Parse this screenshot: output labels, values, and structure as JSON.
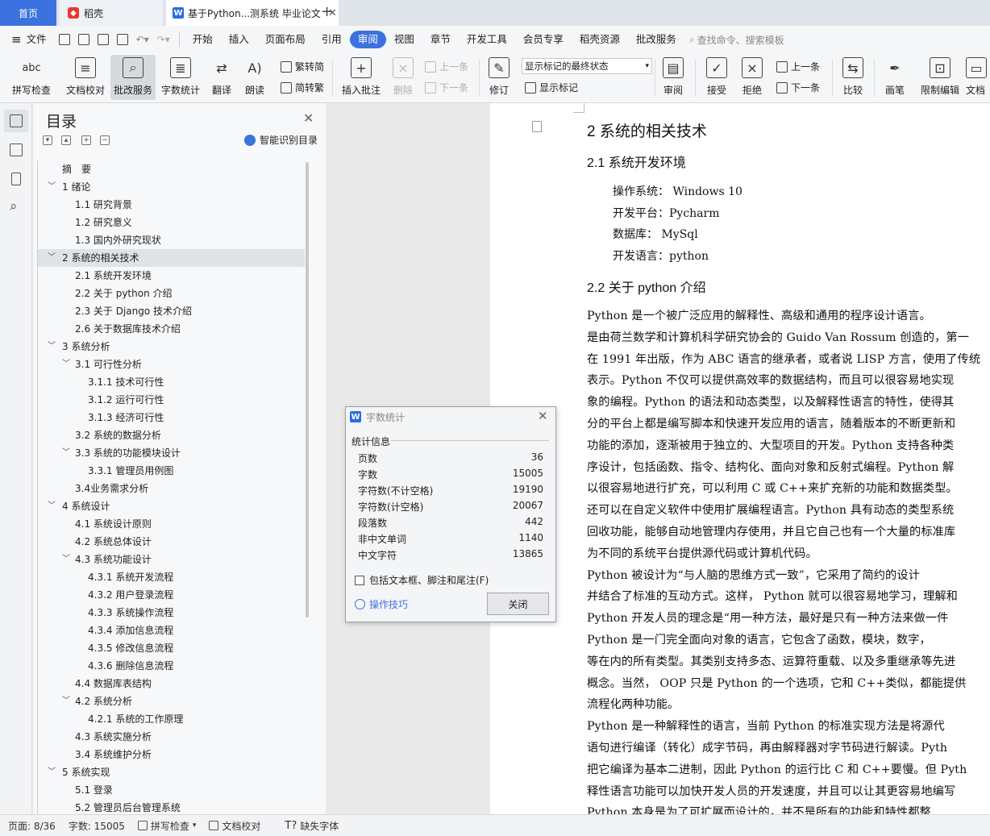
{
  "tabs": {
    "home": "首页",
    "daoke": "稻壳",
    "doc": "基于Python...测系统 毕业论文",
    "new_tab": "+",
    "close": "✕"
  },
  "menu": [
    "文件",
    "开始",
    "插入",
    "页面布局",
    "引用",
    "审阅",
    "视图",
    "章节",
    "开发工具",
    "会员专享",
    "稻壳资源",
    "批改服务"
  ],
  "menu_search": "查找命令、搜索模板",
  "ribbon": {
    "spell_check": "拼写检查",
    "doc_check": "文档校对",
    "review_service": "批改服务",
    "word_count": "字数统计",
    "translate": "翻译",
    "read_aloud": "朗读",
    "trad_convert": "繁转简",
    "simp_convert": "简转繁",
    "insert_comment": "插入批注",
    "delete": "删除",
    "prev_item": "上一条",
    "next_item": "下一条",
    "revise": "修订",
    "markup_select": "显示标记的最终状态",
    "show_markup": "显示标记",
    "review": "审阅",
    "accept": "接受",
    "reject": "拒绝",
    "prev_item2": "上一条",
    "next_item2": "下一条",
    "compare": "比较",
    "pen": "画笔",
    "restrict_edit": "限制编辑",
    "doc_more": "文档"
  },
  "toc": {
    "title": "目录",
    "smart": "智能识别目录",
    "items": [
      {
        "label": "摘　要",
        "level": 0,
        "arrow": ""
      },
      {
        "label": "1  绪论",
        "level": 0,
        "arrow": "﹀"
      },
      {
        "label": "1.1  研究背景",
        "level": 1,
        "arrow": ""
      },
      {
        "label": "1.2  研究意义",
        "level": 1,
        "arrow": ""
      },
      {
        "label": "1.3  国内外研究现状",
        "level": 1,
        "arrow": ""
      },
      {
        "label": "2  系统的相关技术",
        "level": 0,
        "arrow": "﹀"
      },
      {
        "label": "2.1  系统开发环境",
        "level": 1,
        "arrow": ""
      },
      {
        "label": "2.2    关于 python 介绍",
        "level": 1,
        "arrow": ""
      },
      {
        "label": "2.3  关于 Django 技术介绍",
        "level": 1,
        "arrow": ""
      },
      {
        "label": "2.6  关于数据库技术介绍",
        "level": 1,
        "arrow": ""
      },
      {
        "label": "3  系统分析",
        "level": 0,
        "arrow": "﹀"
      },
      {
        "label": "3.1  可行性分析",
        "level": 1,
        "arrow": "﹀"
      },
      {
        "label": "3.1.1  技术可行性",
        "level": 2,
        "arrow": ""
      },
      {
        "label": "3.1.2  运行可行性",
        "level": 2,
        "arrow": ""
      },
      {
        "label": "3.1.3  经济可行性",
        "level": 2,
        "arrow": ""
      },
      {
        "label": "3.2  系统的数据分析",
        "level": 1,
        "arrow": ""
      },
      {
        "label": "3.3  系统的功能模块设计",
        "level": 1,
        "arrow": "﹀"
      },
      {
        "label": "3.3.1 管理员用例图",
        "level": 2,
        "arrow": ""
      },
      {
        "label": "3.4业务需求分析",
        "level": 1,
        "arrow": ""
      },
      {
        "label": "4  系统设计",
        "level": 0,
        "arrow": "﹀"
      },
      {
        "label": "4.1  系统设计原则",
        "level": 1,
        "arrow": ""
      },
      {
        "label": "4.2  系统总体设计",
        "level": 1,
        "arrow": ""
      },
      {
        "label": "4.3  系统功能设计",
        "level": 1,
        "arrow": "﹀"
      },
      {
        "label": "4.3.1  系统开发流程",
        "level": 2,
        "arrow": ""
      },
      {
        "label": "4.3.2  用户登录流程",
        "level": 2,
        "arrow": ""
      },
      {
        "label": "4.3.3  系统操作流程",
        "level": 2,
        "arrow": ""
      },
      {
        "label": "4.3.4  添加信息流程",
        "level": 2,
        "arrow": ""
      },
      {
        "label": "4.3.5  修改信息流程",
        "level": 2,
        "arrow": ""
      },
      {
        "label": "4.3.6  删除信息流程",
        "level": 2,
        "arrow": ""
      },
      {
        "label": "4.4 数据库表结构",
        "level": 1,
        "arrow": ""
      },
      {
        "label": "4.2  系统分析",
        "level": 1,
        "arrow": "﹀"
      },
      {
        "label": "4.2.1  系统的工作原理",
        "level": 2,
        "arrow": ""
      },
      {
        "label": "4.3     系统实施分析",
        "level": 1,
        "arrow": ""
      },
      {
        "label": "3.4     系统维护分析",
        "level": 1,
        "arrow": ""
      },
      {
        "label": "5  系统实现",
        "level": 0,
        "arrow": "﹀"
      },
      {
        "label": "5.1 登录",
        "level": 1,
        "arrow": ""
      },
      {
        "label": "5.2 管理员后台管理系统",
        "level": 1,
        "arrow": ""
      }
    ]
  },
  "document": {
    "h1": "2  系统的相关技术",
    "h2_1": "2.1  系统开发环境",
    "env": [
      "操作系统：  Windows 10",
      "开发平台：Pycharm",
      "数据库：  MySql",
      "开发语言：python"
    ],
    "h2_2": "2.2    关于 python 介绍",
    "lines": [
      "    Python 是一个被广泛应用的解释性、高级和通用的程序设计语言。",
      "是由荷兰数学和计算机科学研究协会的 Guido Van Rossum 创造的，第一",
      "在 1991 年出版，作为 ABC 语言的继承者，或者说 LISP 方言，使用了传统",
      "表示。Python 不仅可以提供高效率的数据结构，而且可以很容易地实现",
      "象的编程。Python 的语法和动态类型，以及解释性语言的特性，使得其",
      "分的平台上都是编写脚本和快速开发应用的语言，随着版本的不断更新和",
      "功能的添加，逐渐被用于独立的、大型项目的开发。Python 支持各种类",
      "序设计，包括函数、指令、结构化、面向对象和反射式编程。Python 解",
      "以很容易地进行扩充，可以利用 C 或 C++来扩充新的功能和数据类型。",
      "还可以在自定义软件中使用扩展编程语言。Python 具有动态的类型系统",
      "回收功能，能够自动地管理内存使用，并且它自己也有一个大量的标准库",
      "为不同的系统平台提供源代码或计算机代码。",
      "    Python 被设计为“与人脑的思维方式一致”，它采用了简约的设计",
      "并结合了标准的互动方式。这样，  Python 就可以很容易地学习，理解和",
      "Python 开发人员的理念是“用一种方法，最好是只有一种方法来做一件",
      "    Python 是一门完全面向对象的语言，它包含了函数，模块，数字，",
      "等在内的所有类型。其类别支持多态、运算符重载、以及多重继承等先进",
      "概念。当然，  OOP 只是 Python 的一个选项，它和 C++类似，都能提供",
      "流程化两种功能。",
      "    Python 是一种解释性的语言，当前 Python 的标准实现方法是将源代",
      "语句进行编译（转化）成字节码，再由解释器对字节码进行解读。Pyth",
      "把它编译为基本二进制，因此 Python 的运行比 C 和 C++要慢。但 Pyth",
      "释性语言功能可以加快开发人员的开发速度，并且可以让其更容易地编写",
      "    Python 本身是为了可扩展而设计的，并不是所有的功能和特性都整"
    ]
  },
  "dialog": {
    "title": "字数统计",
    "section": "统计信息",
    "stats": [
      {
        "label": "页数",
        "value": "36"
      },
      {
        "label": "字数",
        "value": "15005"
      },
      {
        "label": "字符数(不计空格)",
        "value": "19190"
      },
      {
        "label": "字符数(计空格)",
        "value": "20067"
      },
      {
        "label": "段落数",
        "value": "442"
      },
      {
        "label": "非中文单词",
        "value": "1140"
      },
      {
        "label": "中文字符",
        "value": "13865"
      }
    ],
    "include_label": "包括文本框、脚注和尾注(F)",
    "include_checked": false,
    "tips": "操作技巧",
    "close_btn": "关闭"
  },
  "status": {
    "page": "页面: 8/36",
    "words": "字数: 15005",
    "spell": "拼写检查",
    "proof": "文档校对",
    "missing_font": "缺失字体"
  }
}
